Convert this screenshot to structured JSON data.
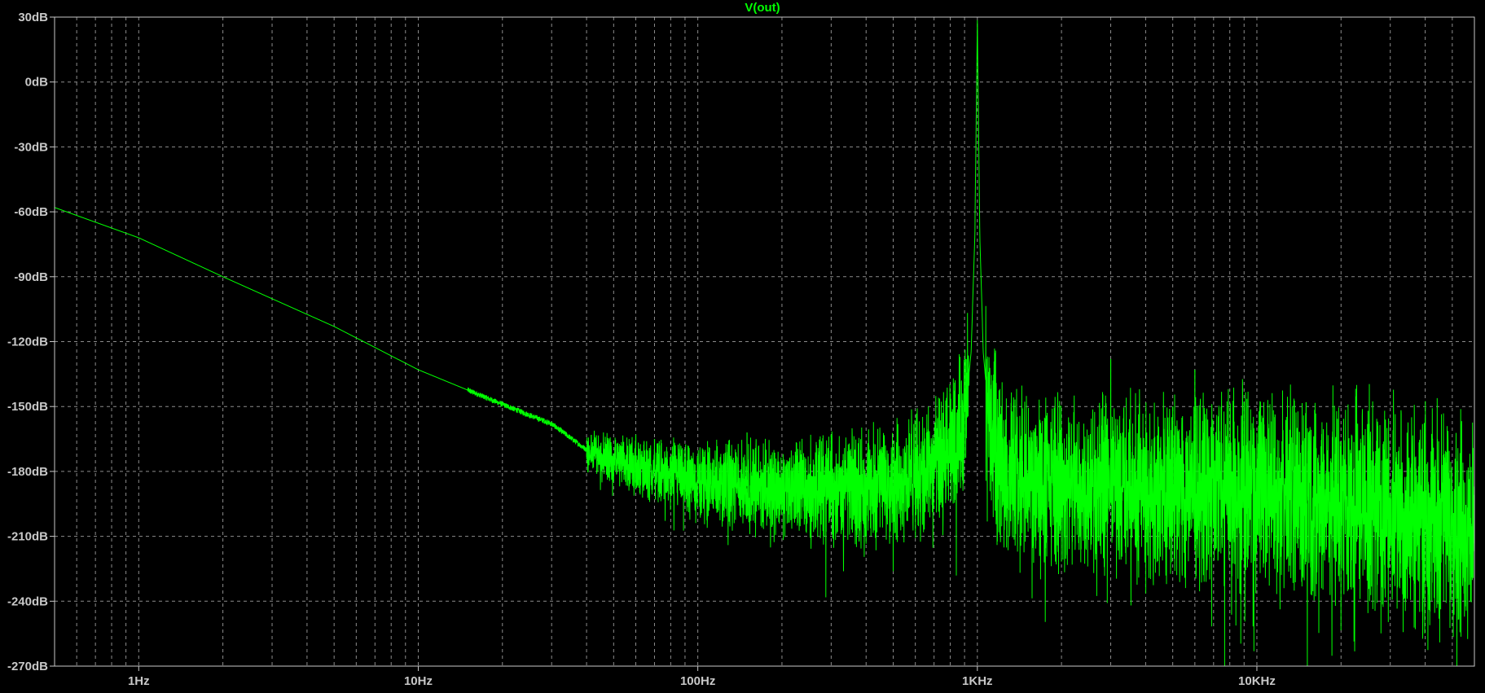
{
  "chart_data": {
    "type": "line",
    "title": "V(out)",
    "xscale": "log",
    "xlim": [
      0.5,
      60000
    ],
    "ylim": [
      -270,
      30
    ],
    "x_ticks": [
      {
        "v": 1,
        "label": "1Hz"
      },
      {
        "v": 10,
        "label": "10Hz"
      },
      {
        "v": 100,
        "label": "100Hz"
      },
      {
        "v": 1000,
        "label": "1KHz"
      },
      {
        "v": 10000,
        "label": "10KHz"
      }
    ],
    "y_ticks": [
      {
        "v": 30,
        "label": "30dB"
      },
      {
        "v": 0,
        "label": "0dB"
      },
      {
        "v": -30,
        "label": "-30dB"
      },
      {
        "v": -60,
        "label": "-60dB"
      },
      {
        "v": -90,
        "label": "-90dB"
      },
      {
        "v": -120,
        "label": "-120dB"
      },
      {
        "v": -150,
        "label": "-150dB"
      },
      {
        "v": -180,
        "label": "-180dB"
      },
      {
        "v": -210,
        "label": "-210dB"
      },
      {
        "v": -240,
        "label": "-240dB"
      },
      {
        "v": -270,
        "label": "-270dB"
      }
    ],
    "grid": true,
    "colors": {
      "background": "#000000",
      "trace": "#00ff00",
      "grid": "#8c8c8c",
      "frame": "#c8c8c8",
      "text": "#c8c8c8"
    },
    "series": [
      {
        "name": "V(out)",
        "color": "#00ff00",
        "trend": [
          [
            0.5,
            -58
          ],
          [
            1,
            -72
          ],
          [
            2,
            -90
          ],
          [
            5,
            -113
          ],
          [
            10,
            -133
          ],
          [
            20,
            -149
          ],
          [
            30,
            -158
          ],
          [
            40,
            -170
          ],
          [
            60,
            -178
          ],
          [
            100,
            -185
          ],
          [
            200,
            -188
          ],
          [
            400,
            -187
          ],
          [
            600,
            -182
          ],
          [
            800,
            -173
          ],
          [
            900,
            -155
          ],
          [
            950,
            -125
          ],
          [
            980,
            -70
          ],
          [
            1000,
            30
          ],
          [
            1020,
            -70
          ],
          [
            1050,
            -125
          ],
          [
            1100,
            -155
          ],
          [
            1200,
            -175
          ],
          [
            1500,
            -185
          ],
          [
            2000,
            -185
          ],
          [
            5000,
            -187
          ],
          [
            10000,
            -187
          ],
          [
            20000,
            -192
          ],
          [
            40000,
            -200
          ],
          [
            60000,
            -205
          ]
        ],
        "noise_band_db": [
          [
            40,
            10
          ],
          [
            100,
            22
          ],
          [
            500,
            32
          ],
          [
            1200,
            45
          ],
          [
            5000,
            50
          ],
          [
            60000,
            60
          ]
        ],
        "spurs": [
          [
            60,
            -163
          ],
          [
            70,
            -165
          ],
          [
            150,
            -162
          ],
          [
            300,
            -163
          ],
          [
            2000,
            -160
          ],
          [
            3000,
            -128
          ],
          [
            3800,
            -158
          ],
          [
            5000,
            -150
          ],
          [
            6000,
            -133
          ],
          [
            9000,
            -148
          ],
          [
            15000,
            -148
          ],
          [
            25000,
            -152
          ],
          [
            40000,
            -155
          ]
        ]
      }
    ]
  }
}
